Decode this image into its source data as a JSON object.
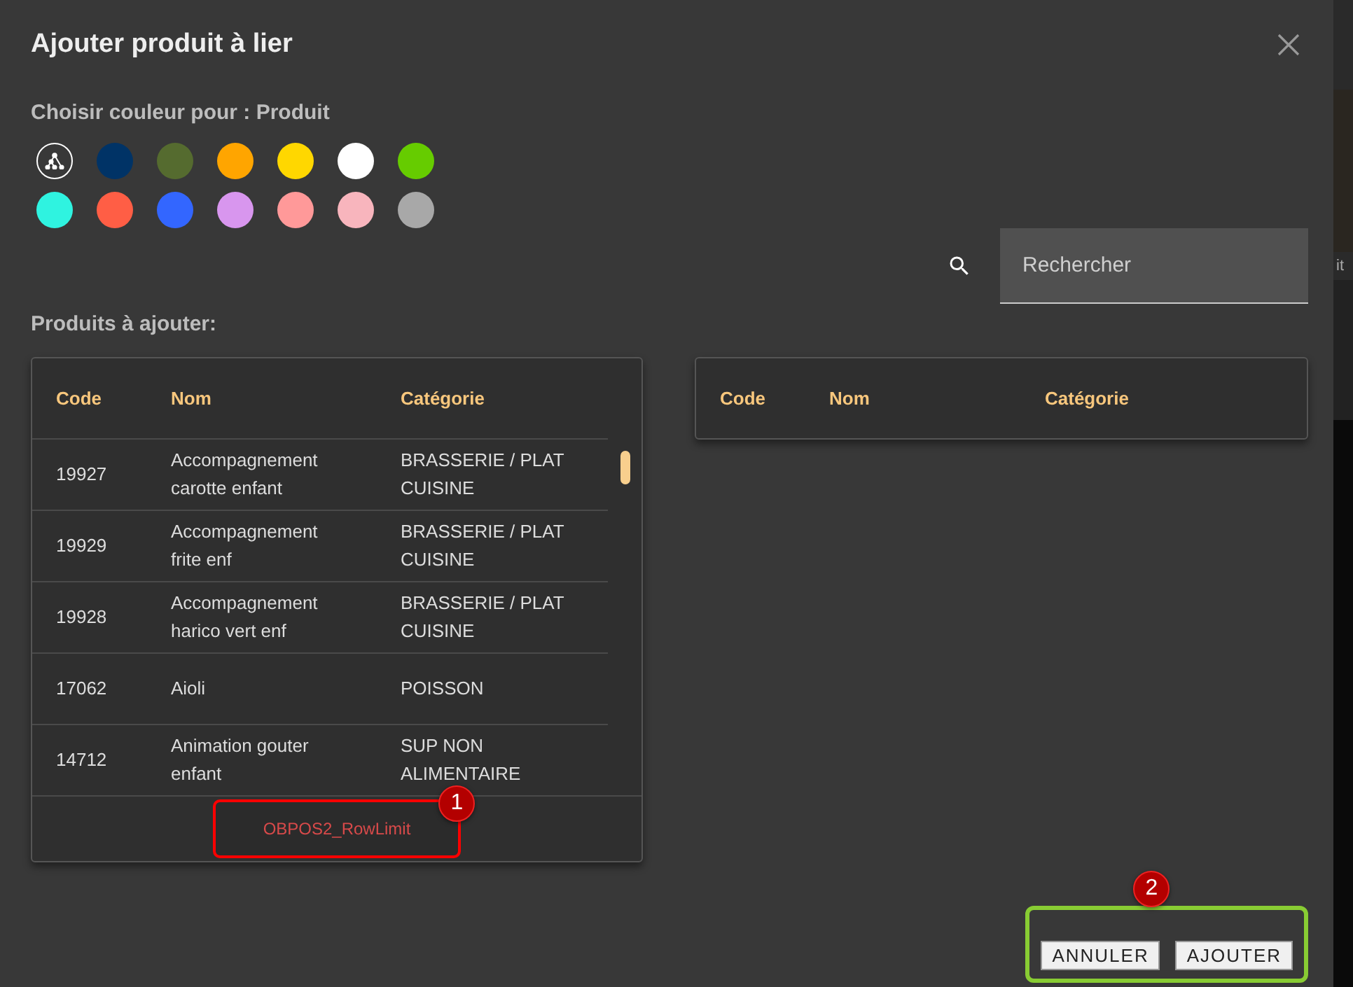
{
  "dialog": {
    "title": "Ajouter produit à lier",
    "color_label": "Choisir couleur pour : Produit",
    "swatches": [
      {
        "kind": "none"
      },
      {
        "kind": "color",
        "color": "#003366"
      },
      {
        "kind": "color",
        "color": "#556b2f"
      },
      {
        "kind": "color",
        "color": "#ffa500"
      },
      {
        "kind": "color",
        "color": "#ffd700"
      },
      {
        "kind": "color",
        "color": "#ffffff"
      },
      {
        "kind": "color",
        "color": "#66cc00"
      },
      {
        "kind": "color",
        "color": "#2ff3e0"
      },
      {
        "kind": "color",
        "color": "#ff5e45"
      },
      {
        "kind": "color",
        "color": "#3366ff"
      },
      {
        "kind": "color",
        "color": "#d896ee"
      },
      {
        "kind": "color",
        "color": "#ff9999"
      },
      {
        "kind": "color",
        "color": "#f8b5bd"
      },
      {
        "kind": "color",
        "color": "#a8a8a8"
      }
    ],
    "search": {
      "placeholder": "Rechercher"
    },
    "section_label": "Produits à ajouter:",
    "available_table": {
      "columns": [
        "Code",
        "Nom",
        "Catégorie"
      ],
      "rows": [
        {
          "code": "19927",
          "name": "Accompagnement carotte enfant",
          "category": "BRASSERIE / PLAT CUISINE"
        },
        {
          "code": "19929",
          "name": "Accompagnement frite enf",
          "category": "BRASSERIE / PLAT CUISINE"
        },
        {
          "code": "19928",
          "name": "Accompagnement harico vert enf",
          "category": "BRASSERIE / PLAT CUISINE"
        },
        {
          "code": "17062",
          "name": "Aioli",
          "category": "POISSON"
        },
        {
          "code": "14712",
          "name": "Animation gouter enfant",
          "category": "SUP NON ALIMENTAIRE"
        }
      ],
      "footer": "OBPOS2_RowLimit"
    },
    "selected_table": {
      "columns": [
        "Code",
        "Nom",
        "Catégorie"
      ]
    },
    "buttons": [
      "ANNULER",
      "AJOUTER"
    ]
  },
  "annotations": [
    {
      "label": "1",
      "color": "#ff0000"
    },
    {
      "label": "2",
      "color": "#88cc33"
    }
  ],
  "background_text": "it"
}
